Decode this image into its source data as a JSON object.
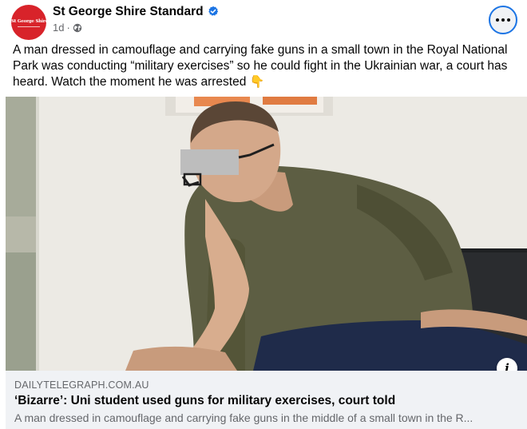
{
  "header": {
    "page_name": "St George Shire Standard",
    "avatar_text": "St George Shire",
    "avatar_color": "#d8232a",
    "verified_icon": "verified-badge-icon",
    "time": "1d",
    "separator": "·",
    "audience_icon": "globe-icon",
    "more_icon": "more-options-icon"
  },
  "caption": {
    "text": "A man dressed in camouflage and carrying fake guns in a small town in the Royal National Park was conducting “military exercises” so he could fight in the Ukrainian war, a court has heard. Watch the moment he was arrested",
    "emoji": "👇"
  },
  "media": {
    "description_icon": "info-icon",
    "info_label": "i"
  },
  "link_preview": {
    "domain": "DAILYTELEGRAPH.COM.AU",
    "headline": "‘Bizarre’: Uni student used guns for military exercises, court told",
    "description": "A man dressed in camouflage and carrying fake guns in the middle of a small town in the R..."
  },
  "colors": {
    "accent": "#1b74e4",
    "secondary_text": "#65676b",
    "preview_bg": "#f0f2f5"
  }
}
